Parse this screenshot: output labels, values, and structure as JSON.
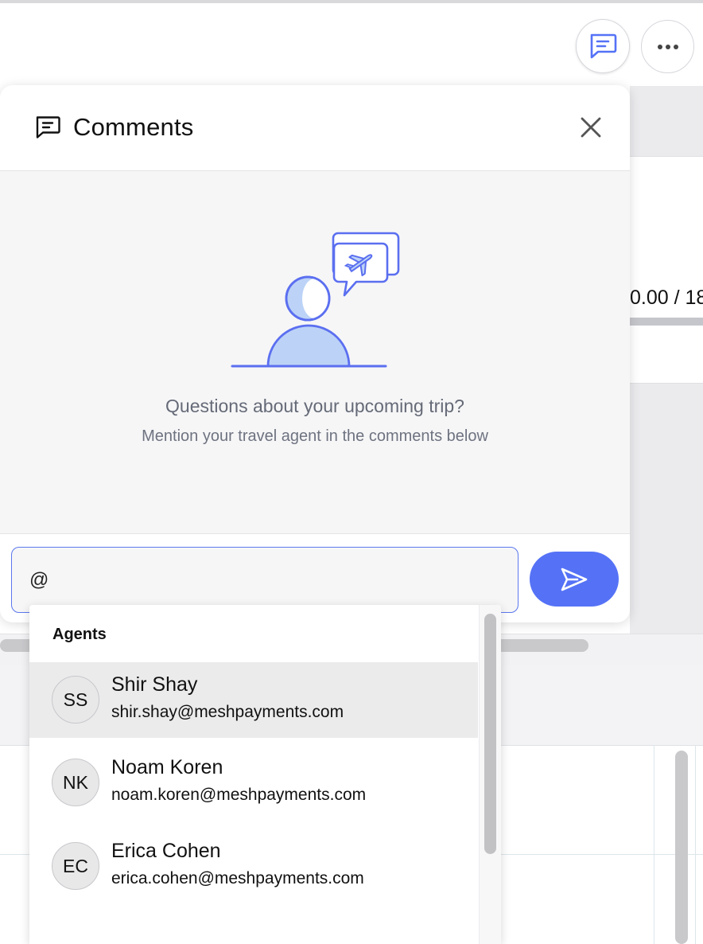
{
  "background": {
    "amount_text": "0.00 / 18"
  },
  "toolbar": {
    "comments_icon": "comment-icon",
    "more_icon": "more-icon"
  },
  "panel": {
    "title": "Comments",
    "header_icon": "comment-icon",
    "close_icon": "close-icon",
    "empty_state": {
      "illustration": "travel-agent-illustration",
      "title": "Questions about your upcoming trip?",
      "subtitle": "Mention your travel agent in the comments below"
    },
    "input": {
      "value": "@"
    },
    "send_icon": "send-icon"
  },
  "mention_dropdown": {
    "header": "Agents",
    "agents": [
      {
        "initials": "SS",
        "name": "Shir Shay",
        "email": "shir.shay@meshpayments.com",
        "selected": true
      },
      {
        "initials": "NK",
        "name": "Noam Koren",
        "email": "noam.koren@meshpayments.com",
        "selected": false
      },
      {
        "initials": "EC",
        "name": "Erica Cohen",
        "email": "erica.cohen@meshpayments.com",
        "selected": false
      }
    ]
  },
  "colors": {
    "accent": "#5572f6",
    "illustration_stroke": "#5b6ff0",
    "illustration_fill": "#bcd3f7",
    "muted_text": "#656a77",
    "selected_row": "#ebebec"
  }
}
